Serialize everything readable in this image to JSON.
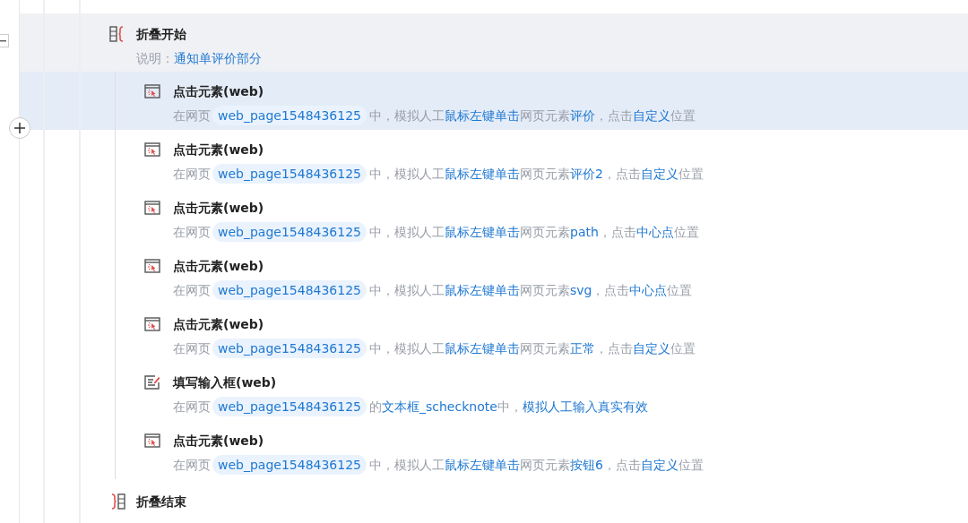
{
  "fold_start": {
    "title": "折叠开始",
    "note_label": "说明：",
    "note": "通知单评价部分"
  },
  "steps": [
    {
      "kind": "click",
      "title": "点击元素(web)",
      "hovered": true,
      "parts": [
        {
          "kind": "text",
          "text": "在网页"
        },
        {
          "kind": "chip",
          "text": "web_page1548436125"
        },
        {
          "kind": "text",
          "text": "中，模拟人工"
        },
        {
          "kind": "link",
          "text": "鼠标左键单击"
        },
        {
          "kind": "text",
          "text": "网页元素"
        },
        {
          "kind": "link",
          "text": "评价"
        },
        {
          "kind": "text",
          "text": "，点击"
        },
        {
          "kind": "link",
          "text": "自定义"
        },
        {
          "kind": "text",
          "text": "位置"
        }
      ]
    },
    {
      "kind": "click",
      "title": "点击元素(web)",
      "hovered": false,
      "parts": [
        {
          "kind": "text",
          "text": "在网页"
        },
        {
          "kind": "chip",
          "text": "web_page1548436125"
        },
        {
          "kind": "text",
          "text": "中，模拟人工"
        },
        {
          "kind": "link",
          "text": "鼠标左键单击"
        },
        {
          "kind": "text",
          "text": "网页元素"
        },
        {
          "kind": "link",
          "text": "评价2"
        },
        {
          "kind": "text",
          "text": "，点击"
        },
        {
          "kind": "link",
          "text": "自定义"
        },
        {
          "kind": "text",
          "text": "位置"
        }
      ]
    },
    {
      "kind": "click",
      "title": "点击元素(web)",
      "hovered": false,
      "parts": [
        {
          "kind": "text",
          "text": "在网页"
        },
        {
          "kind": "chip",
          "text": "web_page1548436125"
        },
        {
          "kind": "text",
          "text": "中，模拟人工"
        },
        {
          "kind": "link",
          "text": "鼠标左键单击"
        },
        {
          "kind": "text",
          "text": "网页元素"
        },
        {
          "kind": "link",
          "text": "path"
        },
        {
          "kind": "text",
          "text": "，点击"
        },
        {
          "kind": "link",
          "text": "中心点"
        },
        {
          "kind": "text",
          "text": "位置"
        }
      ]
    },
    {
      "kind": "click",
      "title": "点击元素(web)",
      "hovered": false,
      "parts": [
        {
          "kind": "text",
          "text": "在网页"
        },
        {
          "kind": "chip",
          "text": "web_page1548436125"
        },
        {
          "kind": "text",
          "text": "中，模拟人工"
        },
        {
          "kind": "link",
          "text": "鼠标左键单击"
        },
        {
          "kind": "text",
          "text": "网页元素"
        },
        {
          "kind": "link",
          "text": "svg"
        },
        {
          "kind": "text",
          "text": "，点击"
        },
        {
          "kind": "link",
          "text": "中心点"
        },
        {
          "kind": "text",
          "text": "位置"
        }
      ]
    },
    {
      "kind": "click",
      "title": "点击元素(web)",
      "hovered": false,
      "parts": [
        {
          "kind": "text",
          "text": "在网页"
        },
        {
          "kind": "chip",
          "text": "web_page1548436125"
        },
        {
          "kind": "text",
          "text": "中，模拟人工"
        },
        {
          "kind": "link",
          "text": "鼠标左键单击"
        },
        {
          "kind": "text",
          "text": "网页元素"
        },
        {
          "kind": "link",
          "text": "正常"
        },
        {
          "kind": "text",
          "text": "，点击"
        },
        {
          "kind": "link",
          "text": "自定义"
        },
        {
          "kind": "text",
          "text": "位置"
        }
      ]
    },
    {
      "kind": "input",
      "title": "填写输入框(web)",
      "hovered": false,
      "parts": [
        {
          "kind": "text",
          "text": "在网页"
        },
        {
          "kind": "chip",
          "text": "web_page1548436125"
        },
        {
          "kind": "text",
          "text": "的"
        },
        {
          "kind": "link",
          "text": "文本框_schecknote"
        },
        {
          "kind": "text",
          "text": "中，"
        },
        {
          "kind": "link",
          "text": "模拟人工输入真实有效"
        }
      ]
    },
    {
      "kind": "click",
      "title": "点击元素(web)",
      "hovered": false,
      "parts": [
        {
          "kind": "text",
          "text": "在网页"
        },
        {
          "kind": "chip",
          "text": "web_page1548436125"
        },
        {
          "kind": "text",
          "text": "中，模拟人工"
        },
        {
          "kind": "link",
          "text": "鼠标左键单击"
        },
        {
          "kind": "text",
          "text": "网页元素"
        },
        {
          "kind": "link",
          "text": "按钮6"
        },
        {
          "kind": "text",
          "text": "，点击"
        },
        {
          "kind": "link",
          "text": "自定义"
        },
        {
          "kind": "text",
          "text": "位置"
        }
      ]
    }
  ],
  "fold_end": {
    "title": "折叠结束"
  }
}
